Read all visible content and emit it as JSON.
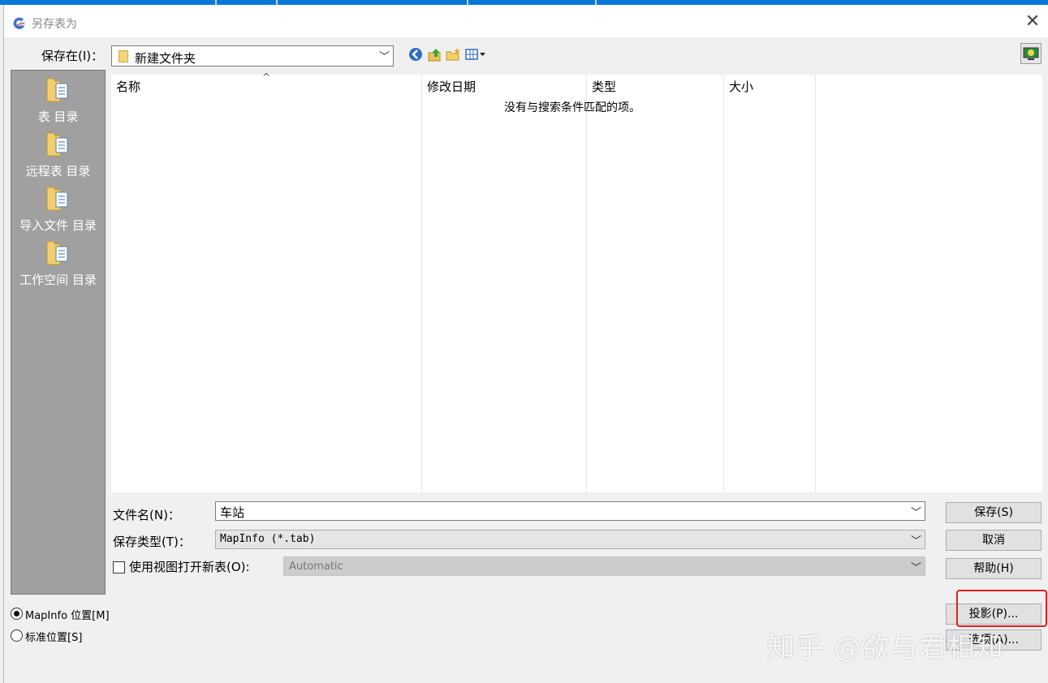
{
  "window": {
    "title": "另存表为",
    "close_glyph": "✕"
  },
  "location": {
    "label": "保存在(I)：",
    "value": "新建文件夹"
  },
  "toolbar": {
    "icons": [
      "back-icon",
      "up-folder-icon",
      "new-folder-icon",
      "view-menu-icon"
    ],
    "desktop_icon": "desktop-icon"
  },
  "places": [
    {
      "label": "表 目录",
      "icon": "folder-doc-icon"
    },
    {
      "label": "远程表 目录",
      "icon": "folder-doc-icon"
    },
    {
      "label": "导入文件 目录",
      "icon": "folder-doc-icon"
    },
    {
      "label": "工作空间 目录",
      "icon": "folder-doc-icon"
    }
  ],
  "filelist": {
    "columns": [
      "名称",
      "修改日期",
      "类型",
      "大小"
    ],
    "sort_caret": "^",
    "empty_message": "没有与搜索条件匹配的项。"
  },
  "form": {
    "filename_label": "文件名(N)：",
    "filename_value": "车站",
    "filetype_label": "保存类型(T)：",
    "filetype_value": "MapInfo (*.tab)",
    "view_checkbox_label": "使用视图打开新表(O):",
    "view_checkbox_checked": false,
    "view_select_value": "Automatic"
  },
  "buttons": {
    "save": "保存(S)",
    "cancel": "取消",
    "help": "帮助(H)",
    "projection": "投影(P)...",
    "options": "选项(A)..."
  },
  "location_options": {
    "mapinfo": "MapInfo 位置[M]",
    "standard": "标准位置[S]",
    "selected": "mapinfo"
  },
  "watermark": "知乎 @欲与君相知",
  "colors": {
    "places_bg": "#a0a0a0",
    "highlight": "#e02020",
    "title_accent": "#0a78d7"
  }
}
